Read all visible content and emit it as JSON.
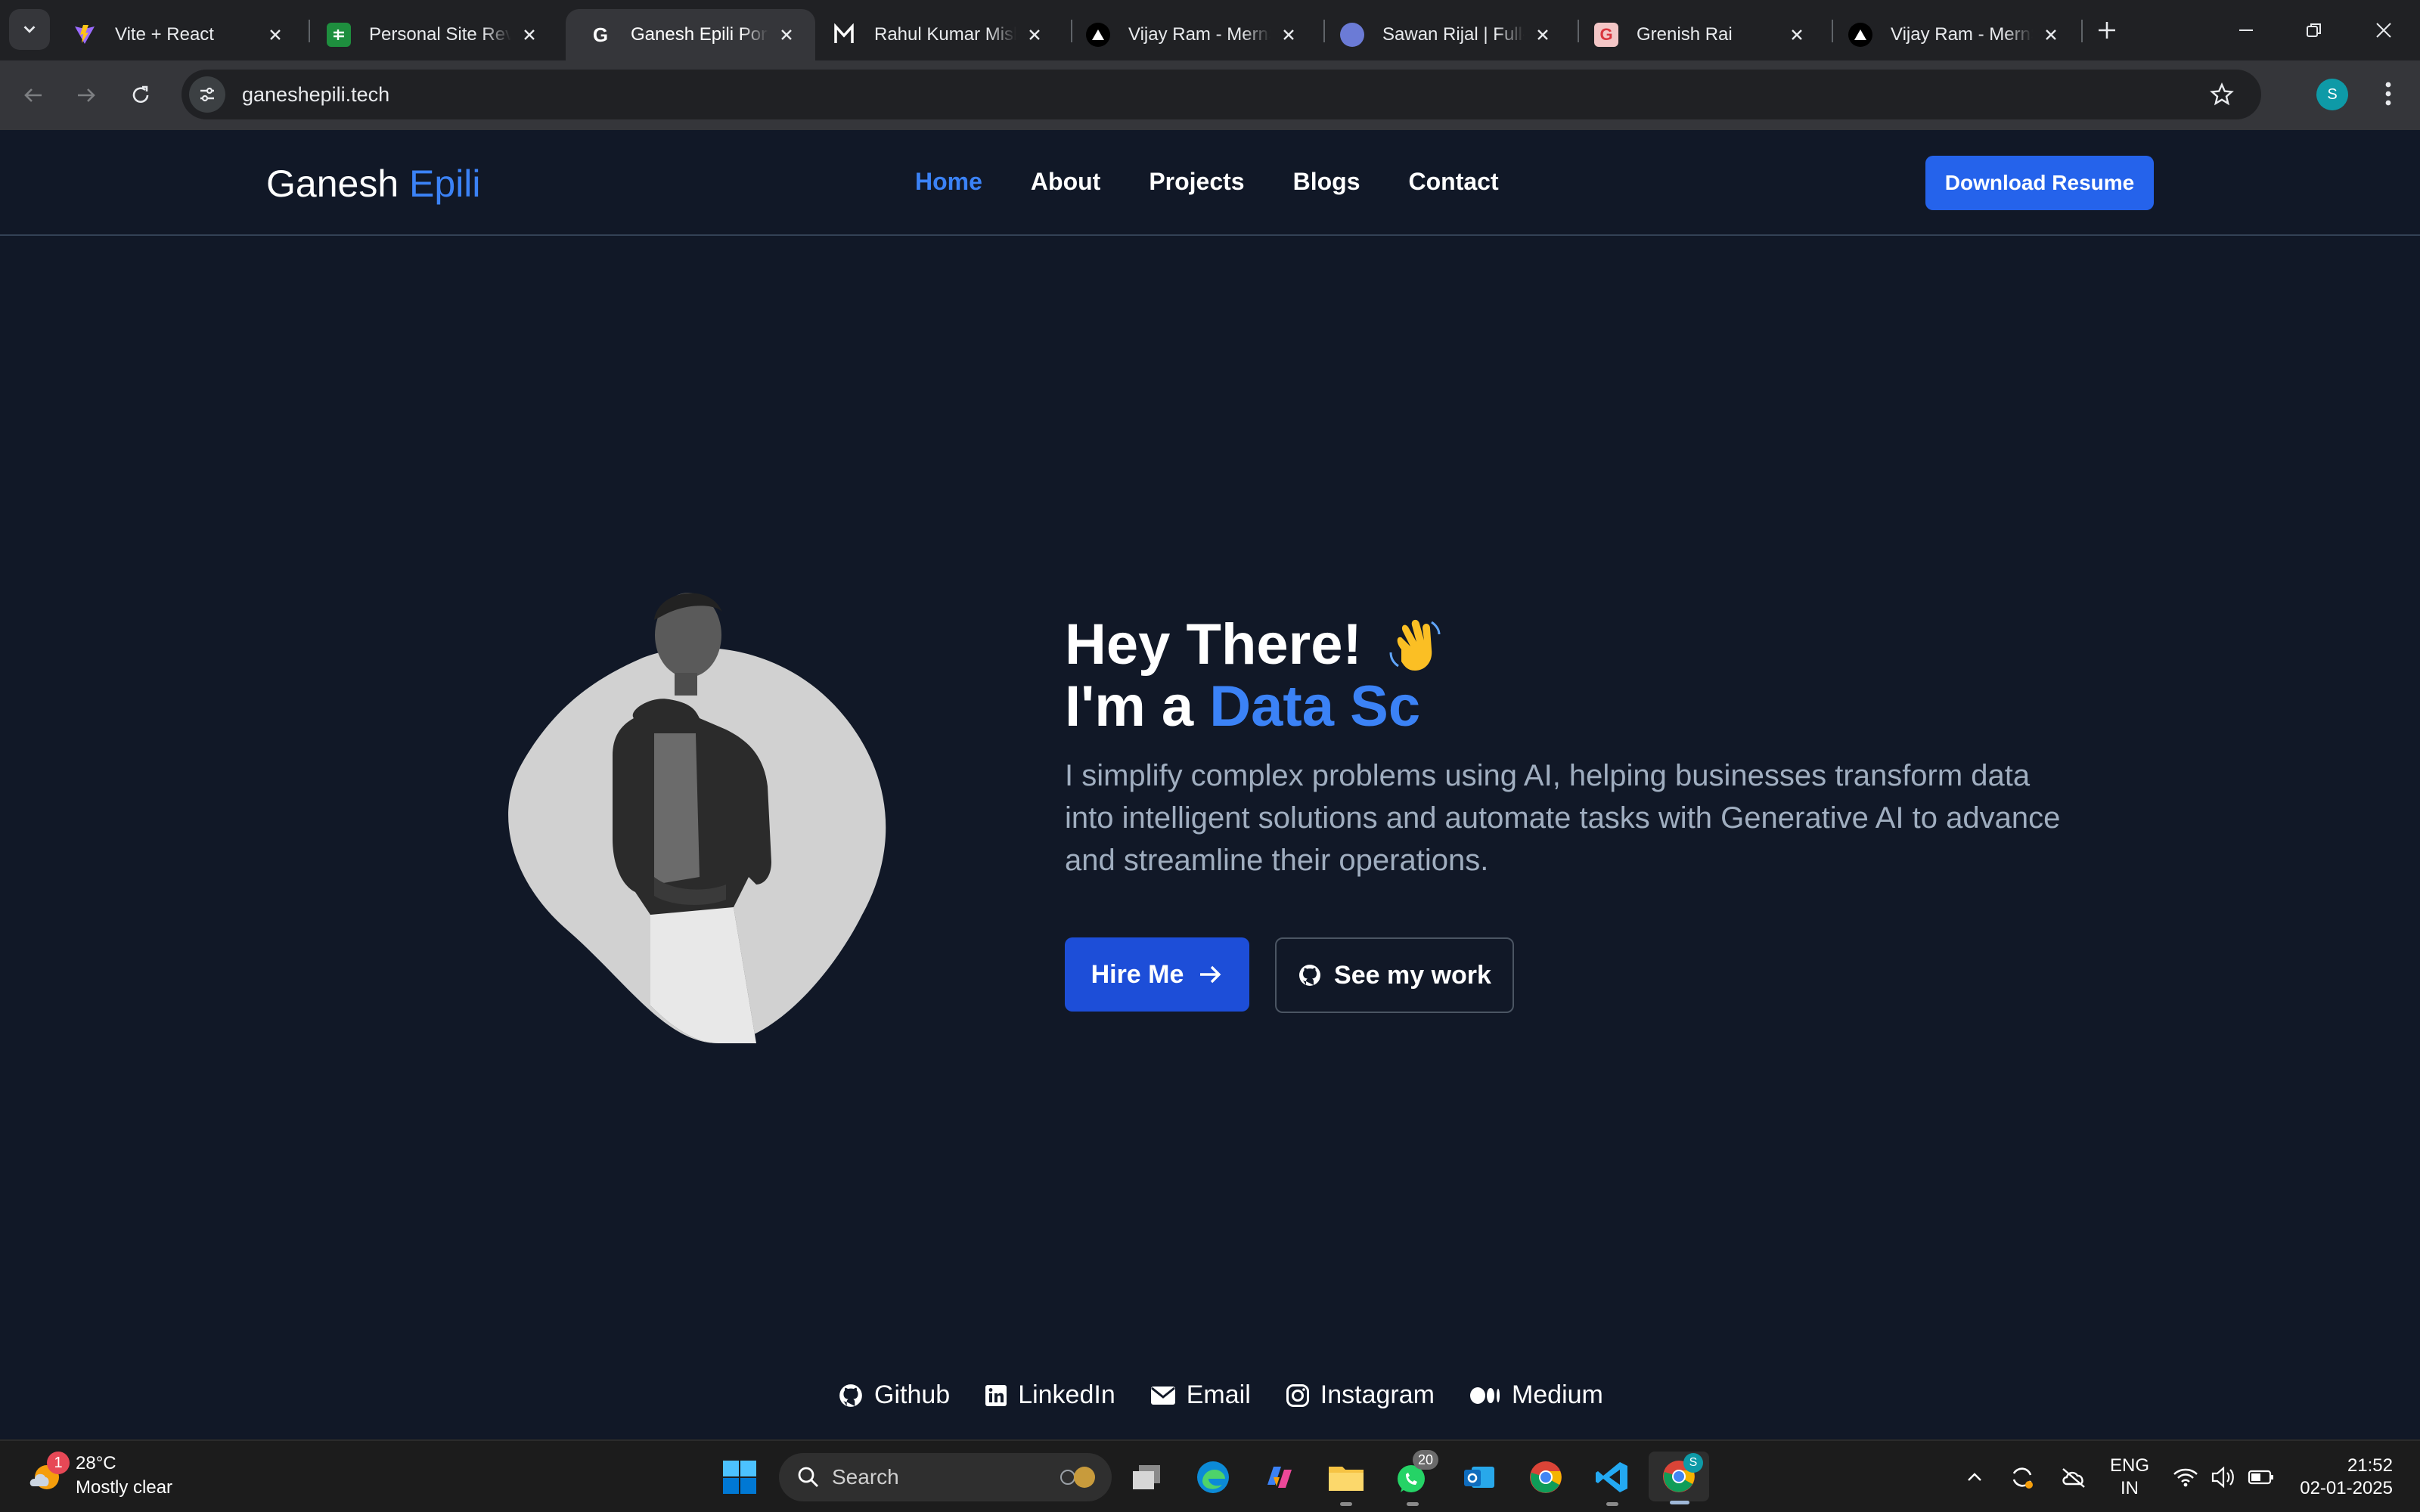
{
  "browser": {
    "tabs": [
      {
        "title": "Vite + React"
      },
      {
        "title": "Personal Site Revie"
      },
      {
        "title": "Ganesh Epili Portfolio"
      },
      {
        "title": "Rahul Kumar Mishra"
      },
      {
        "title": "Vijay Ram - MernStack"
      },
      {
        "title": "Sawan Rijal | Full-Stack"
      },
      {
        "title": "Grenish Rai"
      },
      {
        "title": "Vijay Ram - MernStack"
      }
    ],
    "active_tab_index": 2,
    "url": "ganeshepili.tech",
    "profile_initial": "S"
  },
  "site": {
    "brand_first": "Ganesh",
    "brand_second": "Epili",
    "nav": [
      {
        "label": "Home"
      },
      {
        "label": "About"
      },
      {
        "label": "Projects"
      },
      {
        "label": "Blogs"
      },
      {
        "label": "Contact"
      }
    ],
    "active_nav": "Home",
    "resume_label": "Download Resume",
    "greeting": "Hey There!",
    "role_prefix": "I'm a",
    "role_typed": "Data Sc",
    "intro": "I simplify complex problems using AI, helping businesses transform data into intelligent solutions and automate tasks with Generative AI to advance and streamline their operations.",
    "hire_label": "Hire Me",
    "work_label": "See my work",
    "socials": [
      {
        "label": "Github",
        "icon": "github-icon"
      },
      {
        "label": "LinkedIn",
        "icon": "linkedin-icon"
      },
      {
        "label": "Email",
        "icon": "email-icon"
      },
      {
        "label": "Instagram",
        "icon": "instagram-icon"
      },
      {
        "label": "Medium",
        "icon": "medium-icon"
      }
    ],
    "colors": {
      "background": "#111827",
      "accent": "#3b82f6",
      "button": "#2563eb"
    }
  },
  "taskbar": {
    "weather_temp": "28°C",
    "weather_desc": "Mostly clear",
    "weather_badge": "1",
    "search_label": "Search",
    "whatsapp_badge": "20",
    "chrome_badge": "S",
    "lang_line1": "ENG",
    "lang_line2": "IN",
    "time": "21:52",
    "date": "02-01-2025"
  }
}
